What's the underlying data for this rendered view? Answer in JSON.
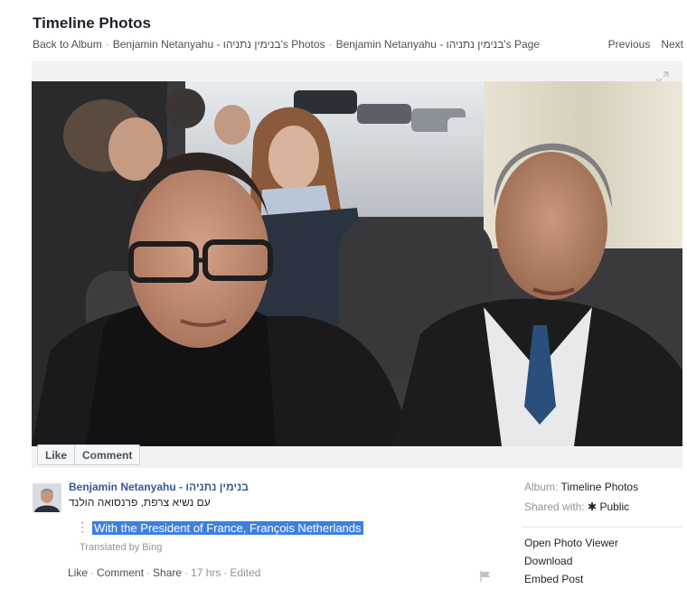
{
  "header": {
    "title": "Timeline Photos",
    "breadcrumb": [
      "Back to Album",
      "Benjamin Netanyahu - בנימין נתניהו's Photos",
      "Benjamin Netanyahu - בנימין נתניהו's Page"
    ],
    "separator": "·",
    "previous": "Previous",
    "next": "Next"
  },
  "photo_actions": {
    "like": "Like",
    "comment": "Comment"
  },
  "post": {
    "author": "Benjamin Netanyahu - בנימין נתניהו",
    "caption": "עם נשיא צרפת, פרנסואה הולנד",
    "kebab": "⋮",
    "translation": "With the President of France, François Netherlands",
    "translated_by": "Translated by Bing",
    "actions": [
      "Like",
      "Comment",
      "Share"
    ],
    "time": "17 hrs",
    "edited": "Edited"
  },
  "sidebar": {
    "album_label": "Album:",
    "album_value": "Timeline Photos",
    "shared_label": "Shared with:",
    "shared_icon": "✱",
    "shared_value": "Public",
    "links": [
      "Open Photo Viewer",
      "Download",
      "Embed Post"
    ]
  },
  "colors": {
    "link": "#365899",
    "highlight": "#3e7fe4",
    "muted": "#90949c"
  }
}
